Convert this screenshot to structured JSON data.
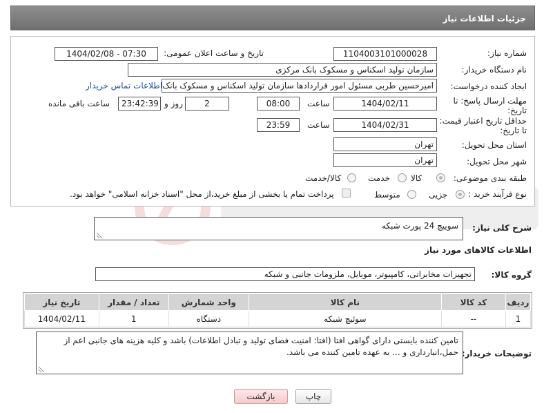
{
  "header": {
    "title": "جزئیات اطلاعات نیاز"
  },
  "form": {
    "need_number_label": "شماره نیاز:",
    "need_number": "1104003101000028",
    "announce_label": "تاریخ و ساعت اعلان عمومی:",
    "announce_value": "1404/02/08 - 07:30",
    "buyer_org_label": "نام دستگاه خریدار:",
    "buyer_org": "سازمان تولید اسکناس و مسکوک بانک مرکزی",
    "creator_label": "ایجاد کننده درخواست:",
    "creator": "امیرحسین طربی مسئول امور قراردادها سازمان تولید اسکناس و مسکوک بانک مرکزی",
    "contact_link": "اطلاعات تماس خریدار",
    "reply_deadline_label": "مهلت ارسال پاسخ: تا تاریخ:",
    "reply_date": "1404/02/11",
    "time_label": "ساعت",
    "reply_time": "08:00",
    "days_value": "2",
    "days_label": "روز و",
    "remaining_time": "23:42:39",
    "remaining_label": "ساعت باقی مانده",
    "price_validity_label": "حداقل تاریخ اعتبار قیمت: تا تاریخ:",
    "price_date": "1404/02/31",
    "price_time": "23:59",
    "delivery_province_label": "استان محل تحویل:",
    "delivery_province": "تهران",
    "delivery_city_label": "شهر محل تحویل:",
    "delivery_city": "تهران",
    "category_label": "طبقه بندی موضوعی:",
    "category_options": [
      "کالا",
      "خدمت",
      "کالا/خدمت"
    ],
    "purchase_type_label": "نوع فرآیند خرید :",
    "purchase_options": [
      "جزیی",
      "متوسط"
    ],
    "payment_note": "پرداخت تمام یا بخشی از مبلغ خرید،از محل \"اسناد خزانه اسلامی\" خواهد بود."
  },
  "summary": {
    "label": "شرح کلی نیاز:",
    "value": "سوییچ 24  پورت شبکه"
  },
  "goods": {
    "section_title": "اطلاعات کالاهای مورد نیاز",
    "group_label": "گروه کالا:",
    "group_value": "تجهیزات مخابراتی، کامپیوتر، موبایل، ملزومات جانبی و شبکه",
    "columns": [
      "ردیف",
      "کد کالا",
      "نام کالا",
      "واحد شمارش",
      "تعداد / مقدار",
      "تاریخ نیاز"
    ],
    "rows": [
      [
        "1",
        "--",
        "سوئیچ شبکه",
        "دستگاه",
        "1",
        "1404/02/11"
      ]
    ]
  },
  "notes": {
    "label": "توضیحات خریدار:",
    "value": "تامین کننده بایستی دارای گواهی افتا (افتا: امنیت فضای تولید و تبادل اطلاعات) باشد و کلیه هزینه های جانبی اعم از حمل،انبارداری و ... به عهده تامین کننده می باشد."
  },
  "buttons": {
    "print": "چاپ",
    "back": "بازگشت"
  }
}
